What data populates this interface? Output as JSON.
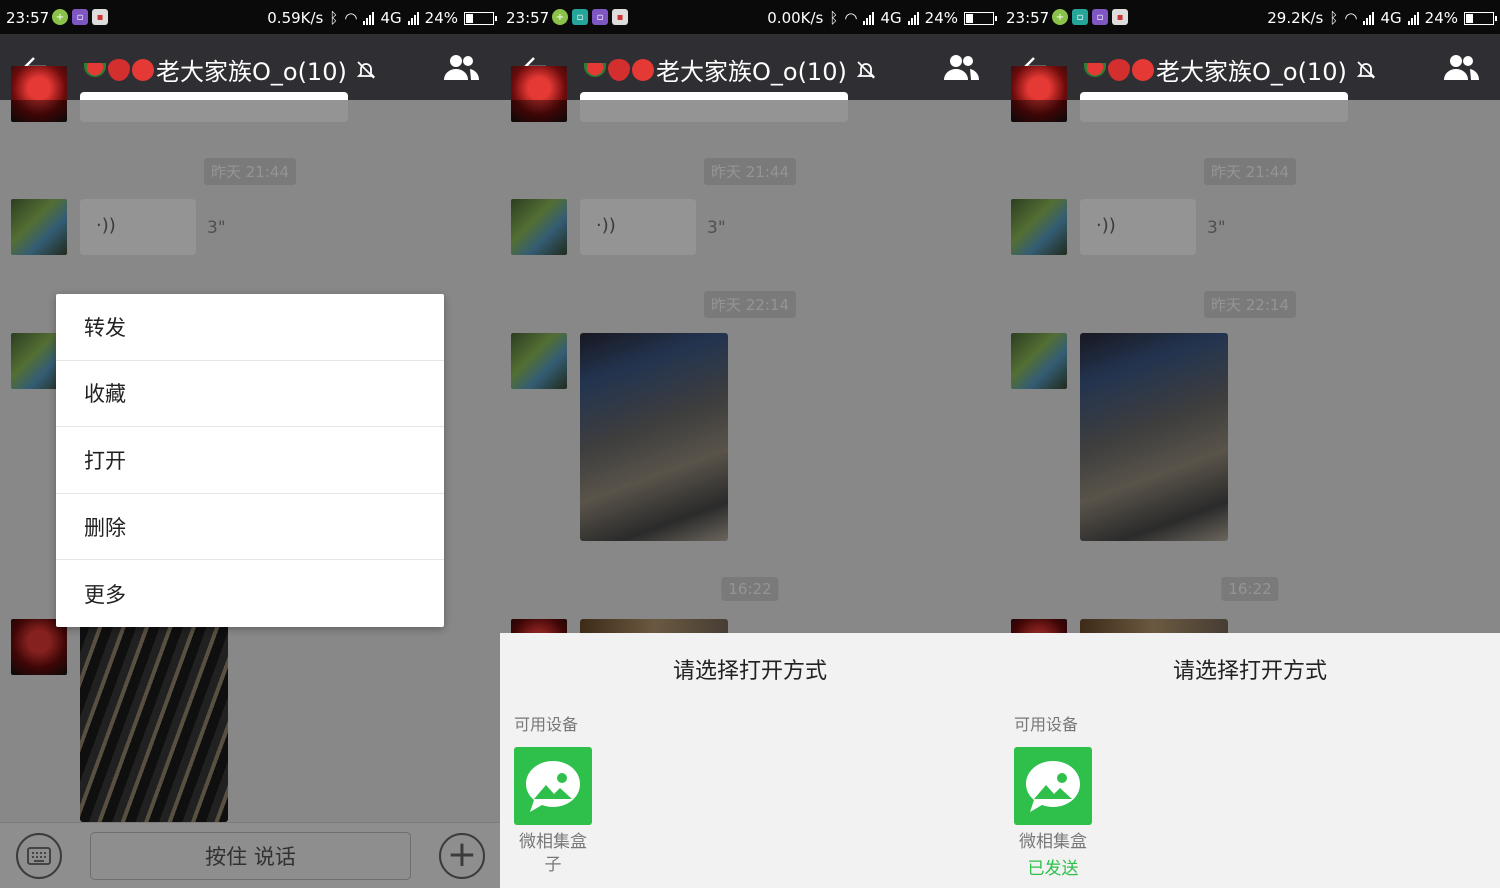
{
  "colors": {
    "accent_green": "#2ec04a",
    "nav_bg": "#2e2e33",
    "chat_bg": "#ebebeb"
  },
  "panels": [
    {
      "status": {
        "time": "23:57",
        "net_speed": "0.59K/s",
        "network": "4G",
        "battery": "24%"
      },
      "nav": {
        "title": "老大家族O_o(10)"
      },
      "chat": {
        "timestamp_1": "昨天 21:44",
        "voice_length": "3\""
      },
      "input": {
        "talk_label": "按住 说话"
      },
      "context_menu": {
        "items": [
          "转发",
          "收藏",
          "打开",
          "删除",
          "更多"
        ]
      }
    },
    {
      "status": {
        "time": "23:57",
        "net_speed": "0.00K/s",
        "network": "4G",
        "battery": "24%"
      },
      "nav": {
        "title": "老大家族O_o(10)"
      },
      "chat": {
        "timestamp_1": "昨天 21:44",
        "voice_length": "3\"",
        "timestamp_2": "昨天 22:14",
        "timestamp_3": "16:22"
      },
      "sheet": {
        "title": "请选择打开方式",
        "section": "可用设备",
        "app_name": "微相集盒子"
      }
    },
    {
      "status": {
        "time": "23:57",
        "net_speed": "29.2K/s",
        "network": "4G",
        "battery": "24%"
      },
      "nav": {
        "title": "老大家族O_o(10)"
      },
      "chat": {
        "timestamp_1": "昨天 21:44",
        "voice_length": "3\"",
        "timestamp_2": "昨天 22:14",
        "timestamp_3": "16:22"
      },
      "sheet": {
        "title": "请选择打开方式",
        "section": "可用设备",
        "app_name": "微相集盒",
        "app_status": "已发送"
      }
    }
  ]
}
